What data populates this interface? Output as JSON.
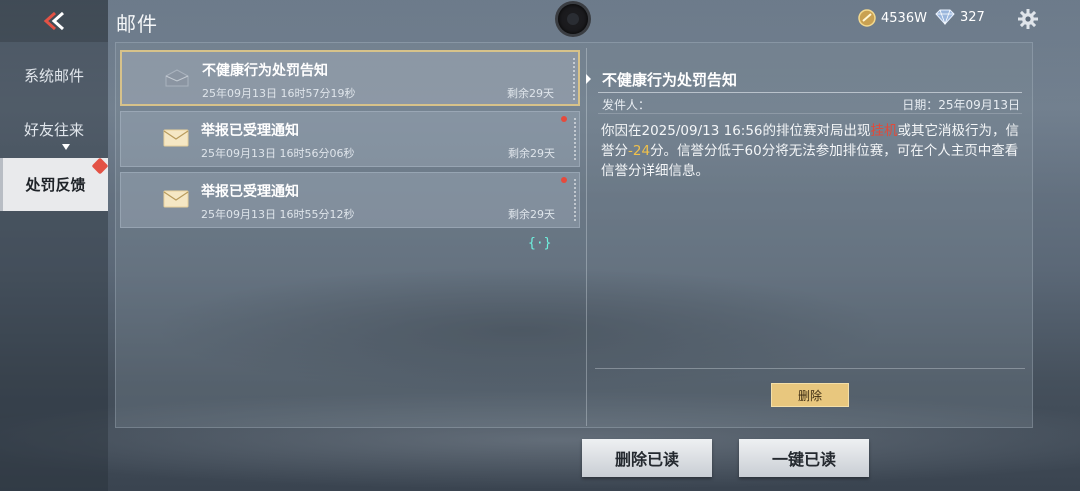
{
  "header": {
    "title": "邮件",
    "back_icon": "double-chevron-left-icon",
    "currency_gold": "4536W",
    "currency_diamond": "327",
    "accent": "#e35245"
  },
  "sidebar": {
    "items": [
      {
        "label": "系统邮件",
        "active": false
      },
      {
        "label": "好友往来",
        "active": false,
        "expandable": true
      },
      {
        "label": "处罚反馈",
        "active": true,
        "badge": true
      }
    ]
  },
  "mails": [
    {
      "subject": "不健康行为处罚告知",
      "date": "25年09月13日 16时57分19秒",
      "remaining": "剩余29天",
      "icon": "envelope-open-icon",
      "selected": true,
      "unread": false
    },
    {
      "subject": "举报已受理通知",
      "date": "25年09月13日 16时56分06秒",
      "remaining": "剩余29天",
      "icon": "envelope-icon",
      "selected": false,
      "unread": true
    },
    {
      "subject": "举报已受理通知",
      "date": "25年09月13日 16时55分12秒",
      "remaining": "剩余29天",
      "icon": "envelope-icon",
      "selected": false,
      "unread": true
    }
  ],
  "loader_text": "{·}",
  "detail": {
    "title": "不健康行为处罚告知",
    "sender_label": "发件人：",
    "date_label": "日期：25年09月13日",
    "body_part1": "你因在2025/09/13 16:56的排位赛对局出现",
    "body_redacted": "挂机",
    "body_part2": "或其它消极行为，信誉分",
    "body_penalty": "-24",
    "body_part3": "分。信誉分低于60分将无法参加排位赛，可在个人主页中查看信誉分详细信息。",
    "delete_label": "删除"
  },
  "footer": {
    "delete_read_label": "删除已读",
    "mark_all_read_label": "一键已读"
  }
}
